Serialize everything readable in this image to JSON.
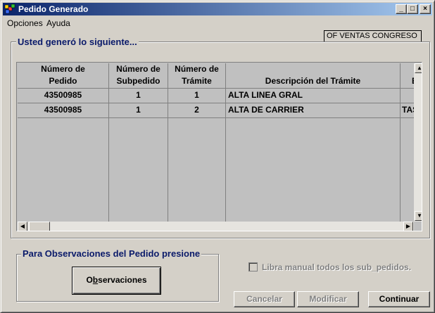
{
  "window": {
    "title": "Pedido Generado",
    "app_icon": "app-icon",
    "controls": {
      "minimize": "_",
      "maximize": "□",
      "close": "×"
    }
  },
  "menu": {
    "items": [
      "Opciones",
      "Ayuda"
    ]
  },
  "tag": "OF VENTAS CONGRESO",
  "summary_group": {
    "label": "Usted generó lo siguiente..."
  },
  "grid": {
    "headers": [
      [
        "Número de",
        "Pedido"
      ],
      [
        "Número de",
        "Subpedido"
      ],
      [
        "Número de",
        "Trámite"
      ],
      [
        "",
        "Descripción del Trámite"
      ],
      [
        "",
        "E"
      ]
    ],
    "rows": [
      [
        "43500985",
        "1",
        "1",
        "ALTA LINEA GRAL",
        ""
      ],
      [
        "43500985",
        "1",
        "2",
        "ALTA DE CARRIER",
        "TASA"
      ]
    ]
  },
  "observaciones_group": {
    "label": "Para Observaciones del Pedido presione"
  },
  "buttons": {
    "observaciones_pre": "O",
    "observaciones_accel": "b",
    "observaciones_post": "servaciones",
    "cancelar": "Cancelar",
    "modificar": "Modificar",
    "continuar": "Continuar"
  },
  "checkbox": {
    "label": "Libra manual todos los sub_pedidos.",
    "checked": false,
    "enabled": false
  }
}
